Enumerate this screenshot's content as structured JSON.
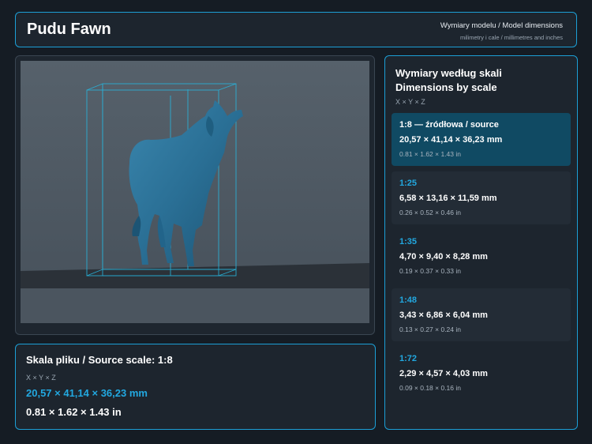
{
  "header": {
    "title": "Pudu Fawn",
    "subtitle": "Wymiary modelu / Model dimensions",
    "units_note": "milimetry i cale / millimetres and inches"
  },
  "viewer": {
    "model_icon": "deer-model-icon",
    "colors": {
      "model": "#2a6f95",
      "box": "#27b6de",
      "floor": "#2b3138",
      "backdrop": "#4e5963"
    }
  },
  "source": {
    "title": "Skala pliku / Source scale: 1:8",
    "axes": "X × Y × Z",
    "mm": "20,57 × 41,14 × 36,23 mm",
    "inches": "0.81 × 1.62 × 1.43 in"
  },
  "scales": {
    "title_line1": "Wymiary według skali",
    "title_line2": "Dimensions by scale",
    "axes": "X × Y × Z",
    "items": [
      {
        "label": "1:8  —  źródłowa / source",
        "mm": "20,57 × 41,14 × 36,23 mm",
        "inches": "0.81 × 1.62 × 1.43 in"
      },
      {
        "label": "1:25",
        "mm": "6,58 × 13,16 × 11,59 mm",
        "inches": "0.26 × 0.52 × 0.46 in"
      },
      {
        "label": "1:35",
        "mm": "4,70 × 9,40 × 8,28 mm",
        "inches": "0.19 × 0.37 × 0.33 in"
      },
      {
        "label": "1:48",
        "mm": "3,43 × 6,86 × 6,04 mm",
        "inches": "0.13 × 0.27 × 0.24 in"
      },
      {
        "label": "1:72",
        "mm": "2,29 × 4,57 × 4,03 mm",
        "inches": "0.09 × 0.18 × 0.16 in"
      }
    ]
  },
  "colors": {
    "accent": "#1c9fd6",
    "highlight": "#22a8e0",
    "active_card": "#104a63"
  }
}
